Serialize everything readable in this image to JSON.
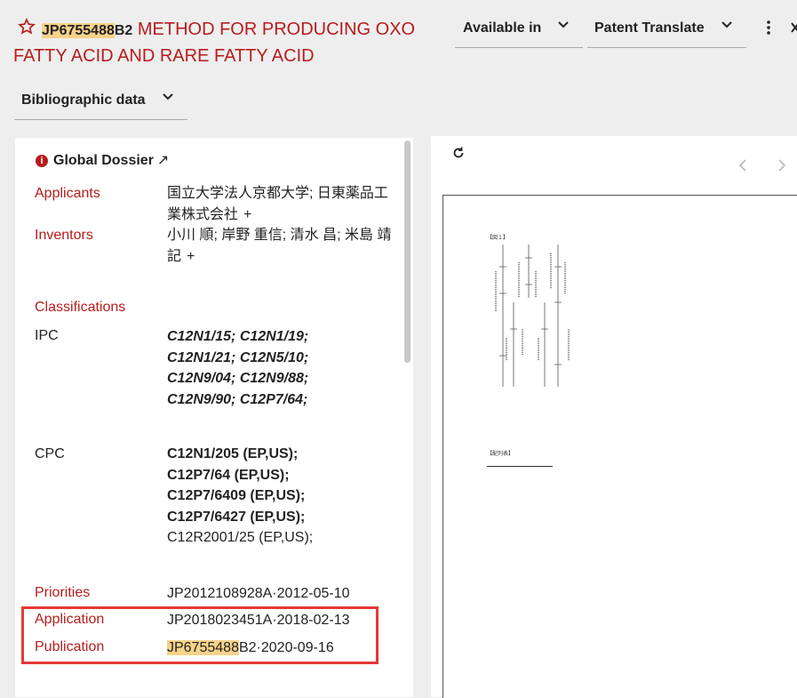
{
  "header": {
    "pub_number": "JP6755488",
    "kind_code": "B2",
    "title": "METHOD FOR PRODUCING OXO FATTY ACID AND RARE FATTY ACID",
    "available_in_label": "Available in",
    "patent_translate_label": "Patent Translate",
    "bibliographic_label": "Bibliographic data"
  },
  "left": {
    "global_dossier_label": "Global Dossier",
    "applicants_label": "Applicants",
    "applicants_value": "国立大学法人京都大学; 日東薬品工業株式会社",
    "inventors_label": "Inventors",
    "inventors_value": "小川 順; 岸野 重信; 清水 昌; 米島 靖記",
    "plus_symbol": "+",
    "classifications_label": "Classifications",
    "ipc_label": "IPC",
    "ipc_lines": [
      "C12N1/15; C12N1/19;",
      "C12N1/21; C12N5/10;",
      "C12N9/04; C12N9/88;",
      "C12N9/90; C12P7/64;"
    ],
    "cpc_label": "CPC",
    "cpc_bold_lines": [
      "C12N1/205 (EP,US);",
      "C12P7/64 (EP,US);",
      "C12P7/6409 (EP,US);",
      "C12P7/6427 (EP,US);"
    ],
    "cpc_plain_line": "C12R2001/25 (EP,US);",
    "priorities_label": "Priorities",
    "priorities_value": "JP2012108928A·2012-05-10",
    "application_label": "Application",
    "application_value": "JP2018023451A·2018-02-13",
    "publication_label": "Publication",
    "publication_number": "JP6755488",
    "publication_suffix": "B2·2020-09-16"
  },
  "viewer": {
    "figure_caption": "【図１】",
    "reference_caption": "【配列表】"
  },
  "colors": {
    "accent_red": "#b71c1c",
    "highlight": "#f7d28a",
    "annotation_box": "#e53935"
  }
}
